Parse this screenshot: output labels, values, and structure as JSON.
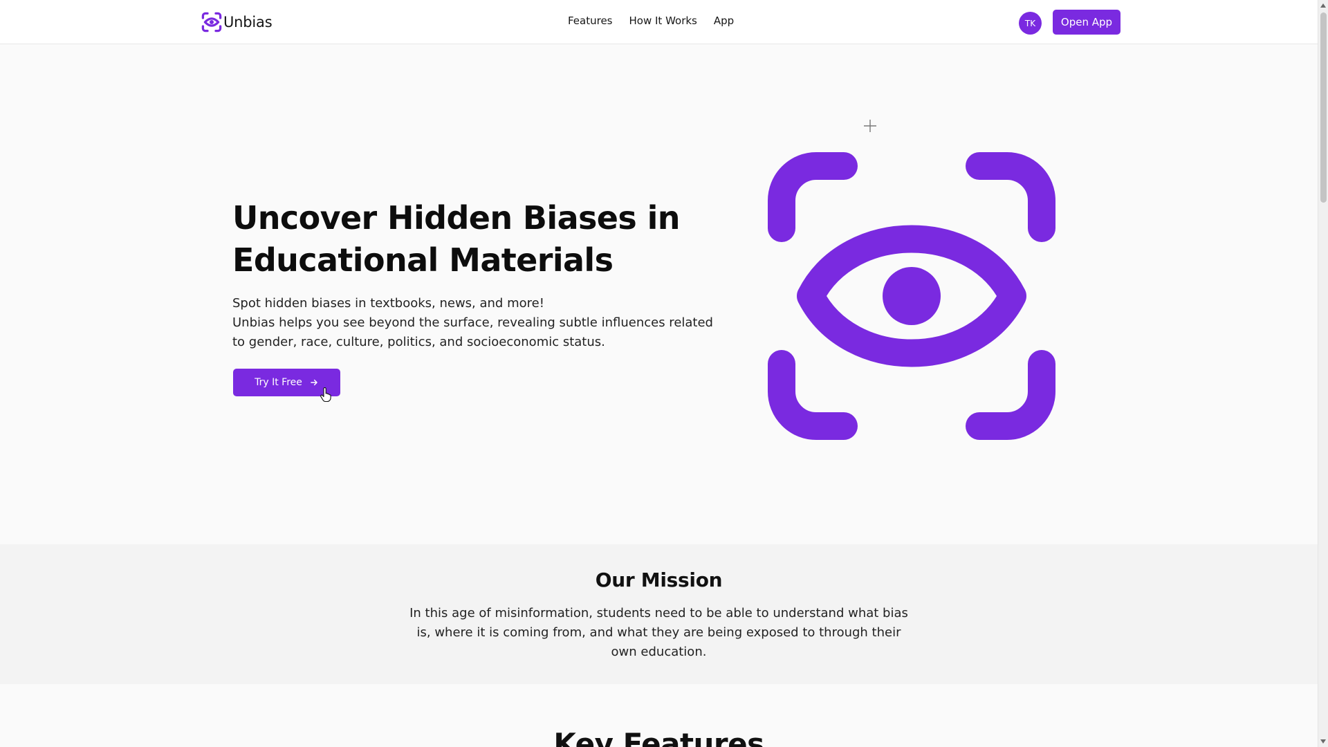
{
  "colors": {
    "brand": "#7a2ae0",
    "text": "#111111",
    "background": "#fafafa",
    "section_alt": "#f3f3f3"
  },
  "header": {
    "logo_text": "Unbias",
    "nav": [
      {
        "label": "Features"
      },
      {
        "label": "How It Works"
      },
      {
        "label": "App"
      }
    ],
    "avatar_initials": "TK",
    "open_app_label": "Open App"
  },
  "hero": {
    "title": "Uncover Hidden Biases in Educational Materials",
    "subtitle_line1": "Spot hidden biases in textbooks, news, and more!",
    "subtitle_line2": "Unbias helps you see beyond the surface, revealing subtle influences related to gender, race, culture, politics, and socioeconomic status.",
    "cta_label": "Try It Free",
    "art_icon": "eye-scan-icon"
  },
  "mission": {
    "title": "Our Mission",
    "text": "In this age of misinformation, students need to be able to understand what bias is, where it is coming from, and what they are being exposed to through their own education."
  },
  "features": {
    "title": "Key Features"
  }
}
